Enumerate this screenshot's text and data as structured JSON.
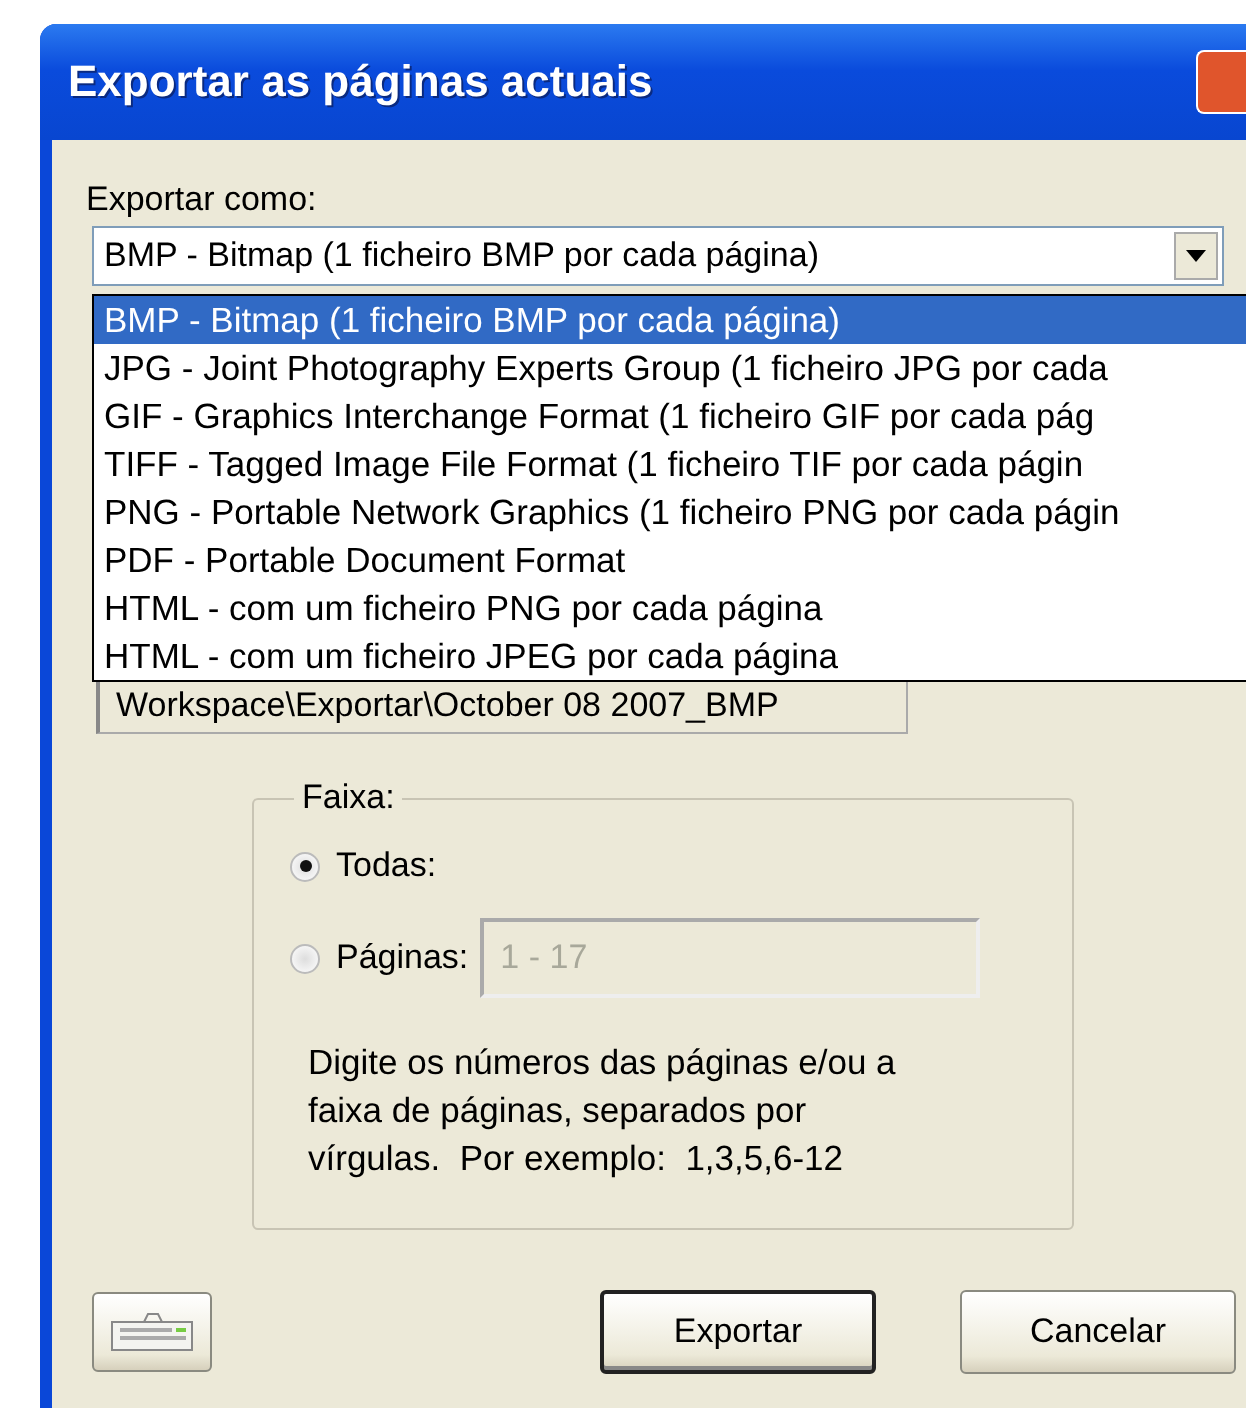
{
  "window": {
    "title": "Exportar as páginas actuais"
  },
  "export_as": {
    "label": "Exportar como:",
    "value": "BMP - Bitmap (1 ficheiro BMP por cada página)",
    "expanded": true,
    "options": [
      {
        "label": "BMP - Bitmap (1 ficheiro BMP por cada página)",
        "selected": true
      },
      {
        "label": "JPG - Joint Photography Experts Group (1 ficheiro JPG por cada",
        "selected": false
      },
      {
        "label": "GIF - Graphics Interchange Format (1 ficheiro GIF por cada pág",
        "selected": false
      },
      {
        "label": "TIFF - Tagged Image File Format (1 ficheiro TIF por cada págin",
        "selected": false
      },
      {
        "label": "PNG - Portable Network Graphics (1 ficheiro PNG por cada págin",
        "selected": false
      },
      {
        "label": "PDF - Portable Document Format",
        "selected": false
      },
      {
        "label": "HTML - com um ficheiro PNG por cada página",
        "selected": false
      },
      {
        "label": "HTML - com um ficheiro JPEG por cada página",
        "selected": false
      }
    ]
  },
  "output_path": {
    "value": "Workspace\\Exportar\\October 08 2007_BMP"
  },
  "range": {
    "title": "Faixa:",
    "options": [
      {
        "label": "Todas:",
        "selected": true
      },
      {
        "label": "Páginas:",
        "selected": false
      }
    ],
    "pages_field": {
      "value": "1 - 17",
      "disabled": true
    },
    "help": "Digite os números das páginas e/ou a\nfaixa de páginas, separados por\nvírgulas.  Por exemplo:  1,3,5,6-12"
  },
  "buttons": [
    {
      "kind": "icon"
    },
    {
      "kind": "text",
      "label": "Exportar",
      "default": true
    },
    {
      "kind": "text",
      "label": "Cancelar",
      "default": false
    }
  ]
}
